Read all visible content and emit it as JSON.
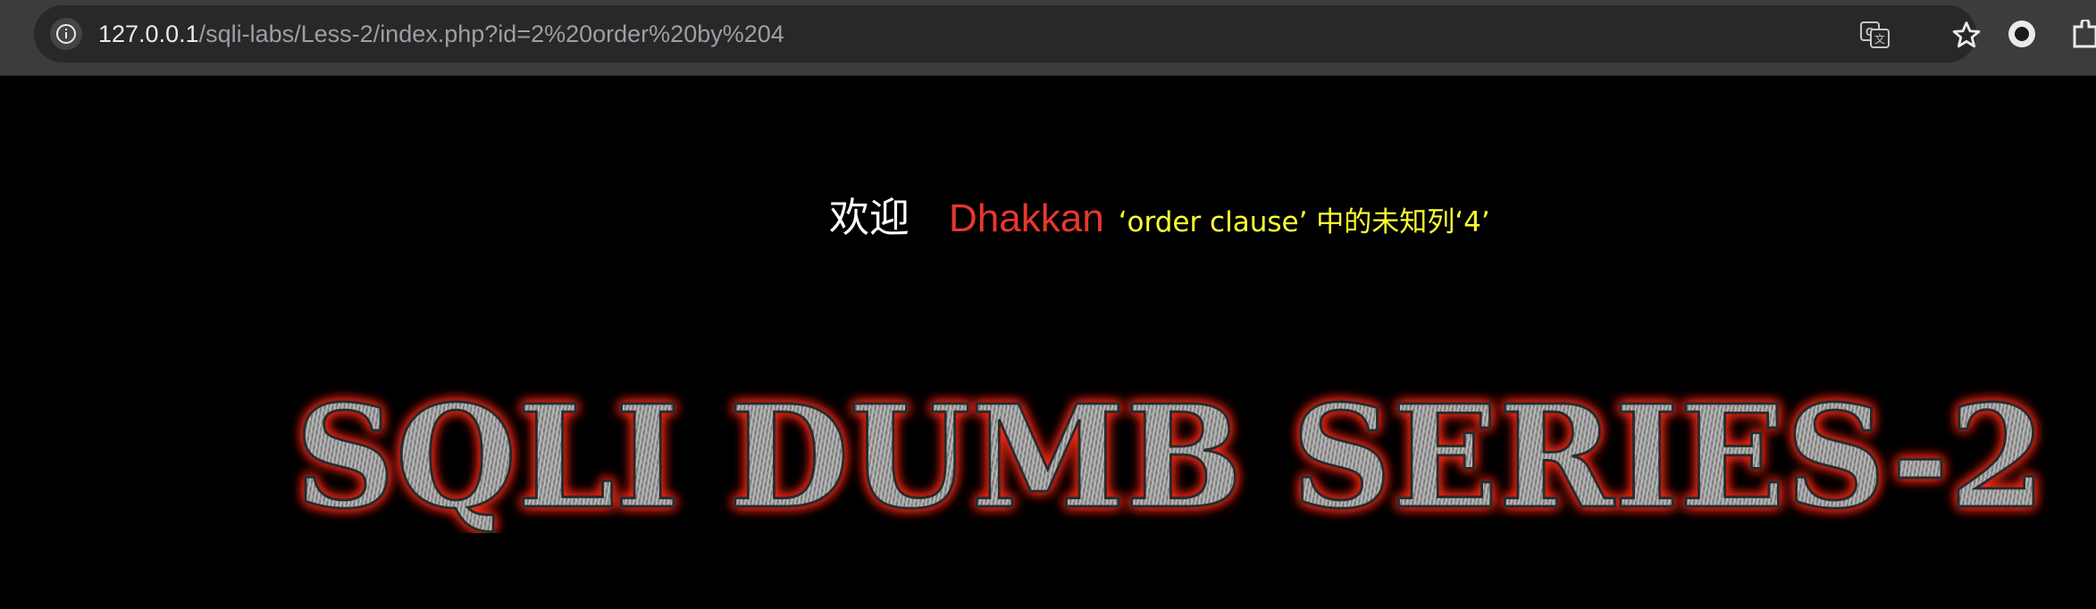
{
  "browser": {
    "url_host": "127.0.0.1",
    "url_path": "/sqli-labs/Less-2/index.php?id=2%20order%20by%204",
    "icons": [
      "site-info-icon",
      "translate-icon",
      "bookmark-star-icon",
      "extension-icon",
      "puzzle-icon"
    ]
  },
  "page": {
    "welcome": "欢迎",
    "username": "Dhakkan",
    "error": "‘order clause’ 中的未知列‘4’",
    "banner": "SQLI DUMB SERIES-2"
  },
  "colors": {
    "background": "#000000",
    "welcome": "#ffffff",
    "username": "#e8372d",
    "error": "#ffff33",
    "banner_glow": "#ff2a1a",
    "banner_fill": "#9a9a9a"
  }
}
